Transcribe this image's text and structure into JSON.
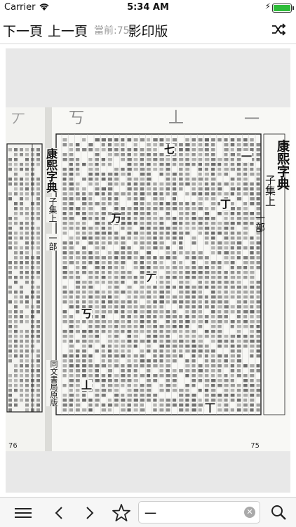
{
  "status": {
    "carrier": "Carrier",
    "time": "5:34 AM"
  },
  "nav": {
    "prev_label": "下一頁",
    "next_label": "上一頁",
    "current_page": "當前:75",
    "title": "影印版"
  },
  "scan": {
    "left_page_number": "76",
    "right_page_number": "75",
    "heading_right": "康熙字典",
    "subheading_right": "子集上",
    "section_right": "一部",
    "heading_left": "康熙字典",
    "subheading_left": "子集上",
    "section_left": "一部",
    "publisher": "同文書局原版",
    "big_chars": [
      "一",
      "丁",
      "七",
      "丂",
      "丄",
      "丅",
      "丆",
      "万"
    ]
  },
  "toolbar": {
    "search_value": "一"
  },
  "colors": {
    "accent": "#2ebd3a",
    "text": "#111111",
    "muted": "#9a9a9a"
  },
  "icons": [
    "wifi-icon",
    "battery-icon",
    "shuffle-icon",
    "menu-icon",
    "back-icon",
    "forward-icon",
    "star-icon",
    "clear-icon",
    "search-icon"
  ]
}
